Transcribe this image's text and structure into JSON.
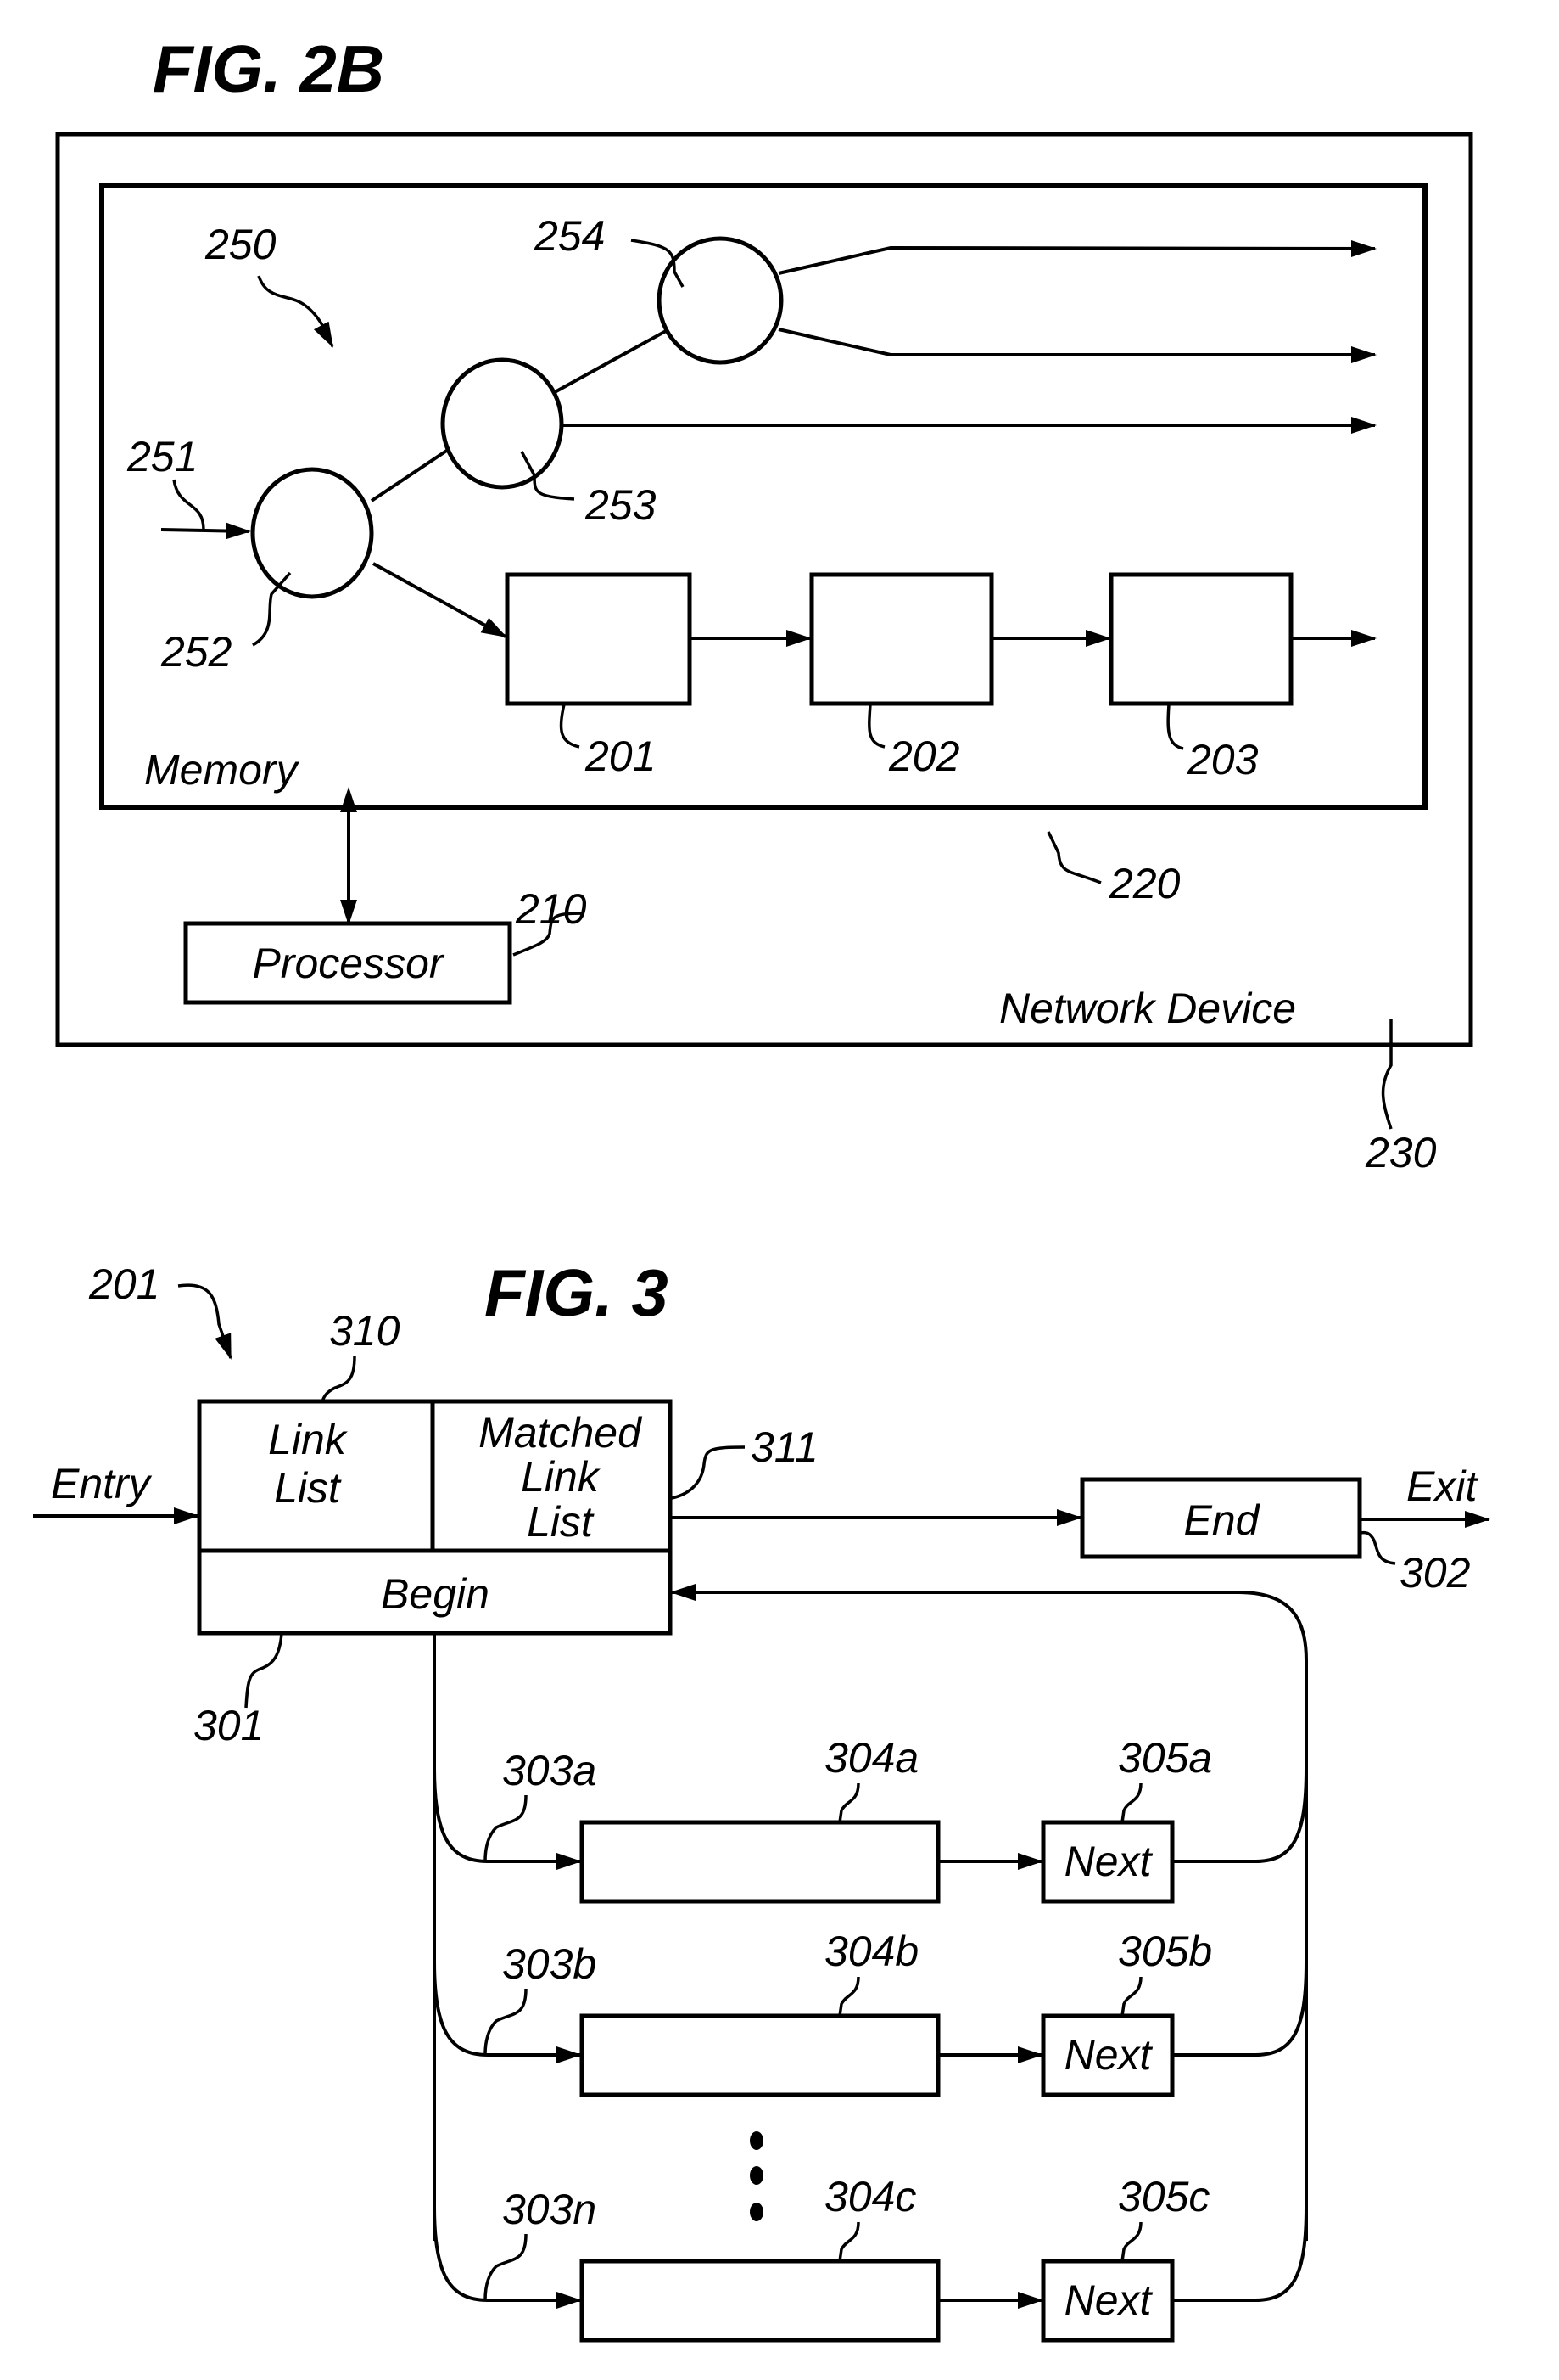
{
  "fig2b": {
    "title": "FIG. 2B",
    "labels": {
      "memory": "Memory",
      "processor": "Processor",
      "network_device": "Network Device"
    },
    "refs": {
      "tree": "250",
      "input": "251",
      "node_252": "252",
      "node_253": "253",
      "node_254": "254",
      "box_201": "201",
      "box_202": "202",
      "box_203": "203",
      "processor": "210",
      "memory": "220",
      "device": "230"
    }
  },
  "fig3": {
    "title": "FIG. 3",
    "labels": {
      "entry": "Entry",
      "exit": "Exit",
      "link_list_line1": "Link",
      "link_list_line2": "List",
      "matched_line1": "Matched",
      "matched_line2": "Link",
      "matched_line3": "List",
      "begin": "Begin",
      "end": "End"
    },
    "refs": {
      "structure": "201",
      "link_list": "310",
      "matched_link_list": "311",
      "begin": "301",
      "end": "302"
    },
    "rows": [
      {
        "pointer": "303a",
        "entry": "304a",
        "next_ref": "305a",
        "next_label": "Next"
      },
      {
        "pointer": "303b",
        "entry": "304b",
        "next_ref": "305b",
        "next_label": "Next"
      },
      {
        "pointer": "303n",
        "entry": "304c",
        "next_ref": "305c",
        "next_label": "Next"
      }
    ]
  }
}
